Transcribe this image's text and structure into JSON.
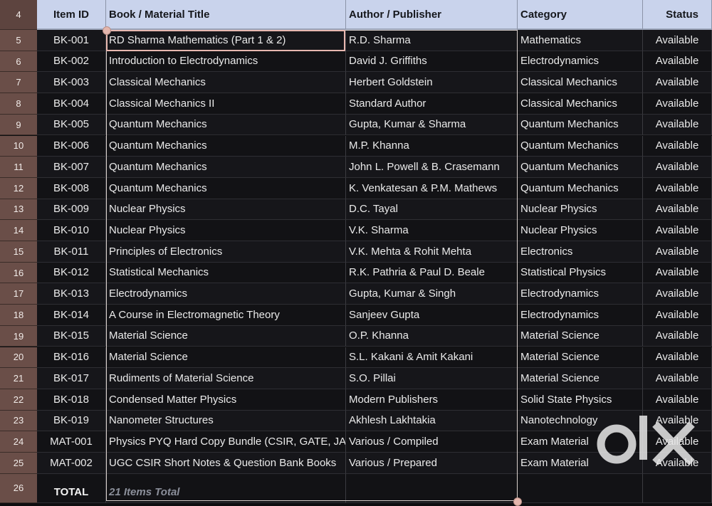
{
  "header": {
    "row_number": "4",
    "columns": [
      "Item ID",
      "Book / Material Title",
      "Author / Publisher",
      "Category",
      "Status"
    ]
  },
  "rows": [
    {
      "num": "5",
      "cells": [
        "BK-001",
        "RD Sharma Mathematics (Part 1 & 2)",
        "R.D. Sharma",
        "Mathematics",
        "Available"
      ]
    },
    {
      "num": "6",
      "cells": [
        "BK-002",
        "Introduction to Electrodynamics",
        "David J. Griffiths",
        "Electrodynamics",
        "Available"
      ]
    },
    {
      "num": "7",
      "cells": [
        "BK-003",
        "Classical Mechanics",
        "Herbert Goldstein",
        "Classical Mechanics",
        "Available"
      ]
    },
    {
      "num": "8",
      "cells": [
        "BK-004",
        "Classical Mechanics II",
        "Standard Author",
        "Classical Mechanics",
        "Available"
      ]
    },
    {
      "num": "9",
      "cells": [
        "BK-005",
        "Quantum Mechanics",
        "Gupta, Kumar & Sharma",
        "Quantum Mechanics",
        "Available"
      ]
    },
    {
      "num": "10",
      "cells": [
        "BK-006",
        "Quantum Mechanics",
        "M.P. Khanna",
        "Quantum Mechanics",
        "Available"
      ]
    },
    {
      "num": "11",
      "cells": [
        "BK-007",
        "Quantum Mechanics",
        "John L. Powell & B. Crasemann",
        "Quantum Mechanics",
        "Available"
      ]
    },
    {
      "num": "12",
      "cells": [
        "BK-008",
        "Quantum Mechanics",
        "K. Venkatesan & P.M. Mathews",
        "Quantum Mechanics",
        "Available"
      ]
    },
    {
      "num": "13",
      "cells": [
        "BK-009",
        "Nuclear Physics",
        "D.C. Tayal",
        "Nuclear Physics",
        "Available"
      ]
    },
    {
      "num": "14",
      "cells": [
        "BK-010",
        "Nuclear Physics",
        "V.K. Sharma",
        "Nuclear Physics",
        "Available"
      ]
    },
    {
      "num": "15",
      "cells": [
        "BK-011",
        "Principles of Electronics",
        "V.K. Mehta & Rohit Mehta",
        "Electronics",
        "Available"
      ]
    },
    {
      "num": "16",
      "cells": [
        "BK-012",
        "Statistical Mechanics",
        "R.K. Pathria & Paul D. Beale",
        "Statistical Physics",
        "Available"
      ]
    },
    {
      "num": "17",
      "cells": [
        "BK-013",
        "Electrodynamics",
        "Gupta, Kumar & Singh",
        "Electrodynamics",
        "Available"
      ]
    },
    {
      "num": "18",
      "cells": [
        "BK-014",
        "A Course in Electromagnetic Theory",
        "Sanjeev Gupta",
        "Electrodynamics",
        "Available"
      ]
    },
    {
      "num": "19",
      "cells": [
        "BK-015",
        "Material Science",
        "O.P. Khanna",
        "Material Science",
        "Available"
      ]
    },
    {
      "num": "20",
      "cells": [
        "BK-016",
        "Material Science",
        "S.L. Kakani & Amit Kakani",
        "Material Science",
        "Available"
      ]
    },
    {
      "num": "21",
      "cells": [
        "BK-017",
        "Rudiments of Material Science",
        "S.O. Pillai",
        "Material Science",
        "Available"
      ]
    },
    {
      "num": "22",
      "cells": [
        "BK-018",
        "Condensed Matter Physics",
        "Modern Publishers",
        "Solid State Physics",
        "Available"
      ]
    },
    {
      "num": "23",
      "cells": [
        "BK-019",
        "Nanometer Structures",
        "Akhlesh Lakhtakia",
        "Nanotechnology",
        "Available"
      ]
    },
    {
      "num": "24",
      "cells": [
        "MAT-001",
        "Physics PYQ Hard Copy Bundle (CSIR, GATE, JAM)",
        "Various / Compiled",
        "Exam Material",
        "Available"
      ]
    },
    {
      "num": "25",
      "cells": [
        "MAT-002",
        "UGC CSIR Short Notes & Question Bank Books",
        "Various / Prepared",
        "Exam Material",
        "Available"
      ]
    }
  ],
  "total": {
    "num": "26",
    "label": "TOTAL",
    "summary": "21 Items Total"
  },
  "watermark": {
    "icon": "olx-logo-icon",
    "text": "OLX"
  },
  "colors": {
    "header_bg": "#c9d3ec",
    "rownum_bg": "#6a4e48",
    "selection": "#e8b8b0"
  }
}
